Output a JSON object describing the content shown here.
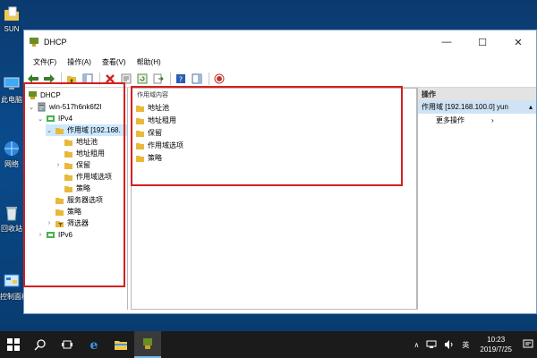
{
  "desktop": {
    "icons": [
      {
        "label": "SUN"
      },
      {
        "label": "此电脑"
      },
      {
        "label": "网络"
      },
      {
        "label": "回收站"
      },
      {
        "label": "控制面板"
      }
    ]
  },
  "window": {
    "title": "DHCP",
    "controls": {
      "minimize": "—",
      "maximize": "☐",
      "close": "✕"
    },
    "menu": [
      "文件(F)",
      "操作(A)",
      "查看(V)",
      "帮助(H)"
    ]
  },
  "tree": {
    "root": "DHCP",
    "server": "win-517h6nk6f2l",
    "ipv4": "IPv4",
    "scope": "作用域 [192.168.",
    "scope_children": [
      "地址池",
      "地址租用",
      "保留",
      "作用域选项",
      "策略"
    ],
    "server_options": "服务器选项",
    "policies": "策略",
    "filters": "筛选器",
    "ipv6": "IPv6"
  },
  "center": {
    "header": "作用域内容",
    "items": [
      "地址池",
      "地址租用",
      "保留",
      "作用域选项",
      "策略"
    ]
  },
  "actions": {
    "header": "操作",
    "scope": "作用域 [192.168.100.0] yun",
    "more": "更多操作"
  },
  "taskbar": {
    "tray_ime": "英",
    "time": "10:23",
    "date": "2019/7/25"
  },
  "colors": {
    "highlight_box": "#d42020",
    "selection": "#cce8ff",
    "taskbar": "#1b1b1b"
  }
}
